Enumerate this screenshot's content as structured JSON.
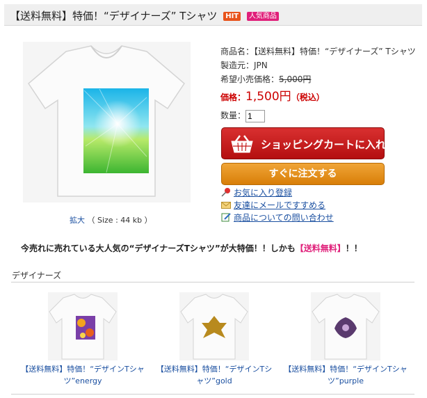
{
  "header": {
    "title": "【送料無料】特価！“デザイナーズ” Tシャツ",
    "badge_hit": "HIT",
    "badge_popular": "人気商品"
  },
  "image": {
    "zoom_label": "拡大",
    "size_info": "（ Size : 44 kb ）"
  },
  "info": {
    "name_label": "商品名：",
    "name_value": "【送料無料】特価！“デザイナーズ” Tシャツ",
    "maker_label": "製造元：",
    "maker_value": "JPN",
    "list_price_label": "希望小売価格：",
    "list_price_value": "5,000円",
    "price_label": "価格：",
    "price_value": "1,500円",
    "tax_label": "（税込）",
    "qty_label": "数量：",
    "qty_value": "1"
  },
  "buttons": {
    "cart": "ショッピングカートに入れる",
    "order": "すぐに注文する"
  },
  "links": [
    {
      "label": "お気に入り登録",
      "icon": "pin-icon"
    },
    {
      "label": "友達にメールですすめる",
      "icon": "envelope-icon"
    },
    {
      "label": "商品についての問い合わせ",
      "icon": "note-edit-icon"
    }
  ],
  "promo": {
    "text": "今売れに売れている大人気の“デザイナーズTシャツ”が大特価！！しかも",
    "highlight": "【送料無料】",
    "tail": "！！"
  },
  "related": {
    "section_title": "デザイナーズ",
    "items": [
      {
        "line1": "【送料無料】特価！“デザインTシャ",
        "line2": "ツ”energy"
      },
      {
        "line1": "【送料無料】特価！“デザインTシ",
        "line2": "ャツ”gold"
      },
      {
        "line1": "【送料無料】特価！“デザインTシャ",
        "line2": "ツ”purple"
      }
    ]
  },
  "colors": {
    "price_red": "#cc0000",
    "cart_button": "#c41b1b",
    "order_button": "#e68f18",
    "link_blue": "#1a4fa0",
    "promo_pink": "#e0207a"
  }
}
